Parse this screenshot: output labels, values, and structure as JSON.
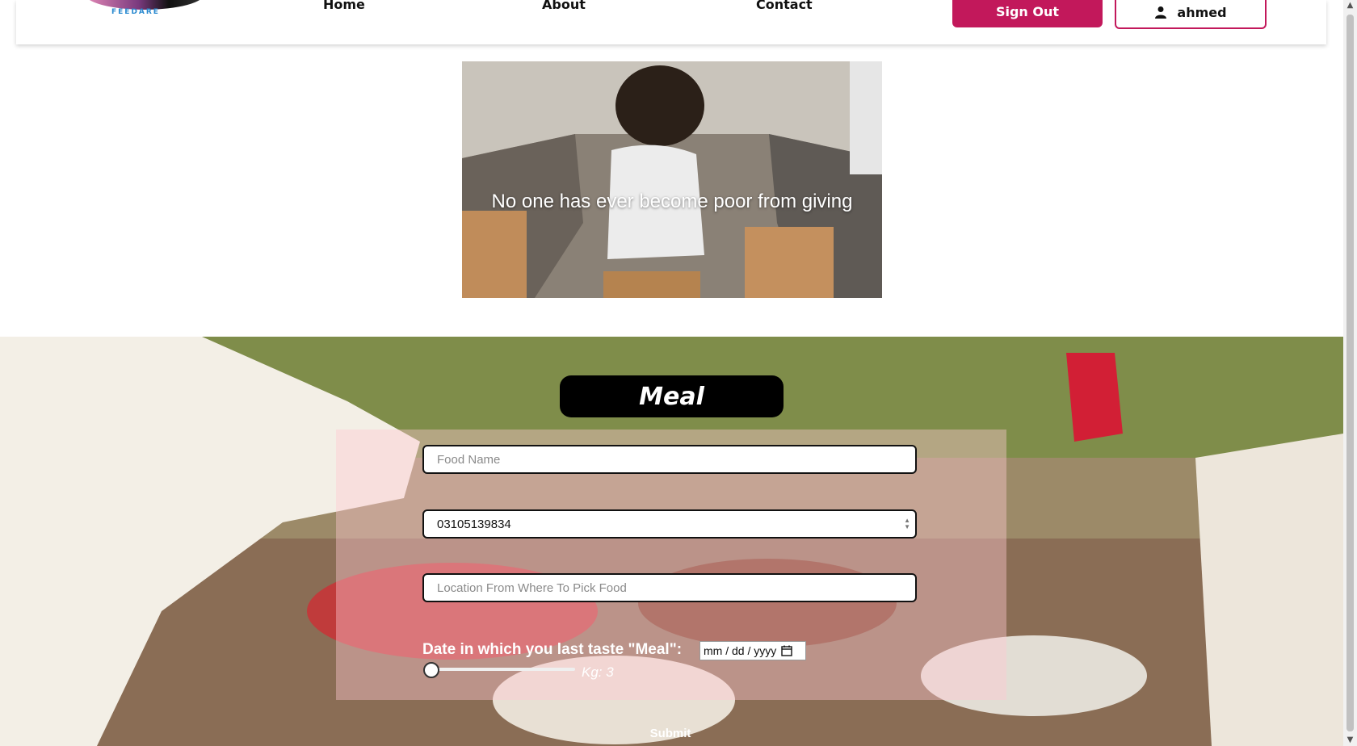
{
  "nav": {
    "logo_text": "FEEDARE",
    "links": [
      "Home",
      "About",
      "Contact"
    ],
    "signout_label": "Sign Out",
    "user_label": "ahmed"
  },
  "hero": {
    "caption": "No one has ever become poor from giving"
  },
  "meal_form": {
    "title": "Meal",
    "food_name_placeholder": "Food Name",
    "phone_value": "03105139834",
    "location_placeholder": "Location From Where To Pick Food",
    "date_label": "Date in which you last taste \"Meal\":",
    "date_placeholder": "mm / dd / yyyy",
    "kg_label": "Kg: 3",
    "kg_value": 3,
    "submit_label": "Submit"
  },
  "colors": {
    "brand": "#c2185b",
    "title_bg": "#000000"
  }
}
